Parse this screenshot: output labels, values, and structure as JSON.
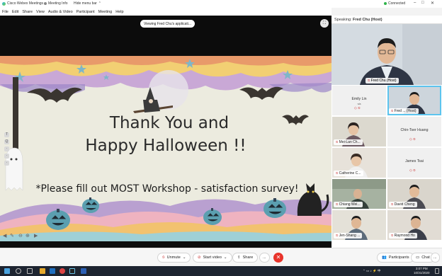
{
  "window": {
    "app_title": "Cisco Webex Meetings",
    "meeting_info": "Meeting Info",
    "hide_menu_bar": "Hide menu bar",
    "connected": "Connected"
  },
  "menu": [
    "File",
    "Edit",
    "Share",
    "View",
    "Audio & Video",
    "Participant",
    "Meeting",
    "Help"
  ],
  "share": {
    "viewing_label": "Viewing Fred Chu's applicati...",
    "fullscreen_icon": "fullscreen-icon"
  },
  "slide": {
    "line1": "Thank You and",
    "line2": "Happy Halloween !!",
    "line3": "*Please fill out MOST Workshop - satisfaction survey!",
    "tools": [
      "T",
      "Q",
      "·",
      "·",
      "·"
    ]
  },
  "panel": {
    "speaking_prefix": "Speaking:",
    "speaking_name": "Fred Chu (Host)",
    "speaker_label": "Fred Chu (Host)"
  },
  "participants": [
    {
      "name": "Emily Lin",
      "sub": "n/a",
      "video": false
    },
    {
      "name": "Fred ... (Host)",
      "video": true
    },
    {
      "name": "Mei-Lan Ch...",
      "video": true
    },
    {
      "name": "Chin-Tser Huang",
      "video": false
    },
    {
      "name": "Catherine C...",
      "video": true
    },
    {
      "name": "James Tsai",
      "video": false
    },
    {
      "name": "Chiang Wei...",
      "video": true
    },
    {
      "name": "David Cheng",
      "video": true
    },
    {
      "name": "Jen-Shang ...",
      "video": true
    },
    {
      "name": "Raymond Ho",
      "video": true
    }
  ],
  "controls": {
    "unmute": "Unmute",
    "start_video": "Start video",
    "share": "Share",
    "more": "...",
    "end": "✕",
    "participants": "Participants",
    "chat": "Chat",
    "more_right": "..."
  },
  "taskbar": {
    "time": "3:07 PM",
    "date": "10/31/2020"
  },
  "colors": {
    "accent": "#5cc4ee",
    "end_red": "#e8332a",
    "taskbar": "#1d2430"
  }
}
